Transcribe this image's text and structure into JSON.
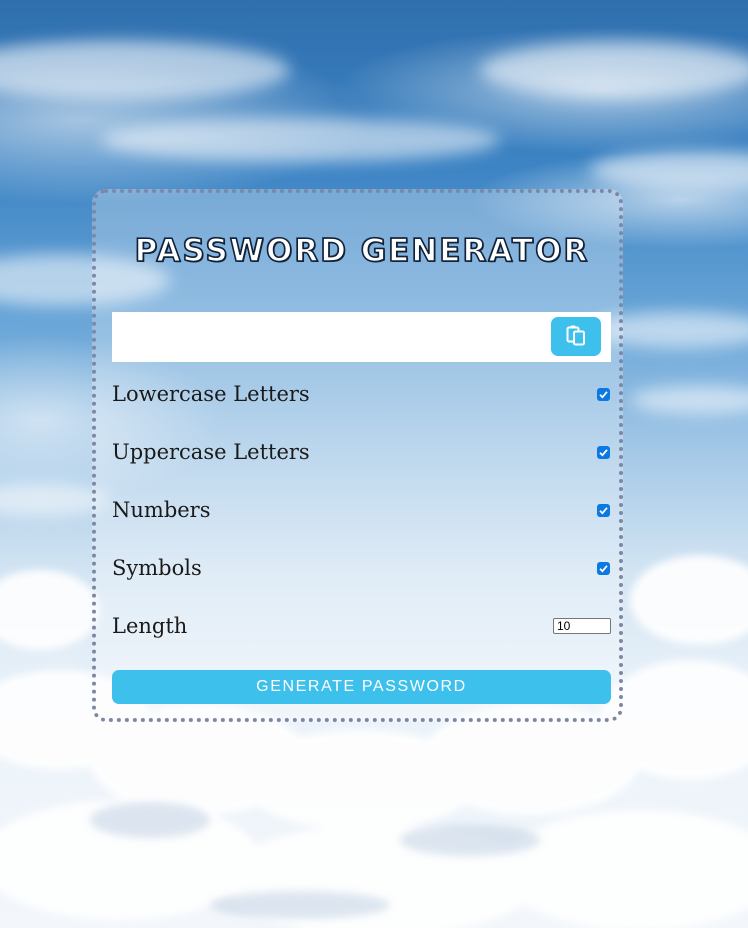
{
  "app": {
    "title": "PASSWORD GENERATOR"
  },
  "output": {
    "value": "",
    "copy_icon": "clipboard-copy-icon"
  },
  "options": [
    {
      "label": "Lowercase Letters",
      "checked": true
    },
    {
      "label": "Uppercase Letters",
      "checked": true
    },
    {
      "label": "Numbers",
      "checked": true
    },
    {
      "label": "Symbols",
      "checked": true
    }
  ],
  "length": {
    "label": "Length",
    "value": "10"
  },
  "generate_button": {
    "label": "GENERATE PASSWORD"
  },
  "colors": {
    "accent": "#3ec0ec",
    "checkbox": "#0b78e3",
    "card_border": "#7d87a6"
  }
}
